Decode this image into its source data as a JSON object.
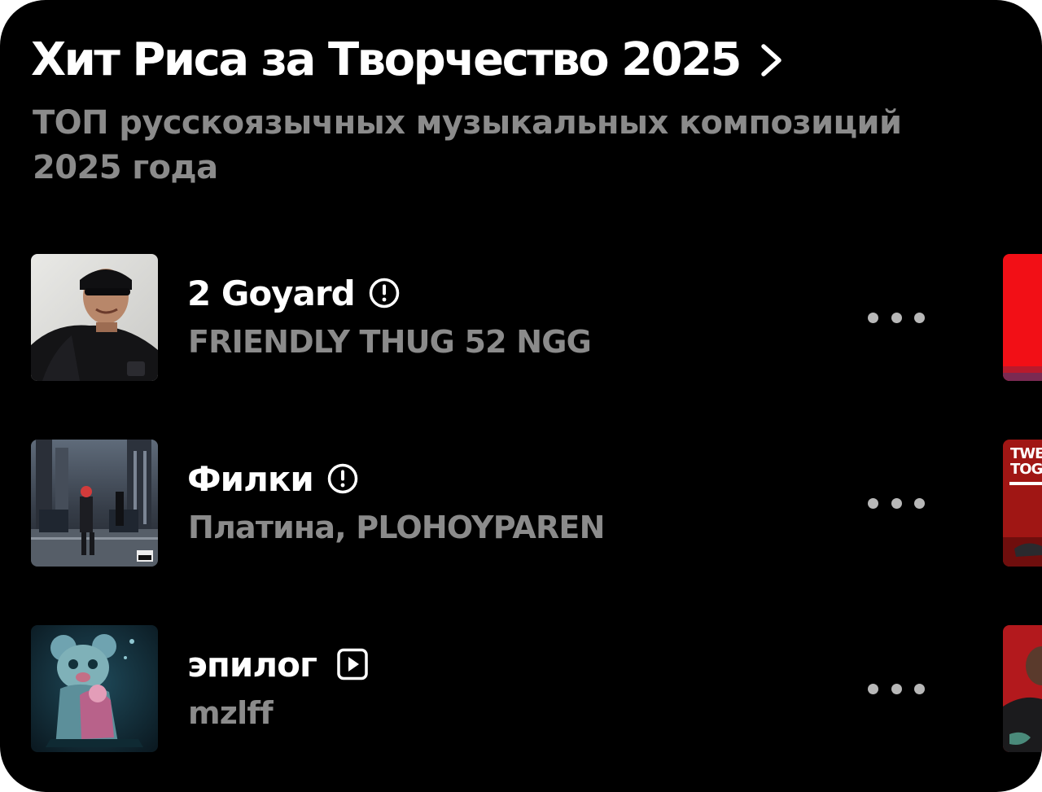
{
  "playlist": {
    "title": "Хит Риса за Творчество 2025",
    "chevron_icon": "chevron-right-icon",
    "description": "ТОП русскоязычных музыкальных композиций 2025 года"
  },
  "tracks": [
    {
      "title": "2 Goyard",
      "badge_icon": "explicit-icon",
      "artist": "FRIENDLY THUG 52 NGG",
      "more_icon": "more-dots-icon"
    },
    {
      "title": "Филки",
      "badge_icon": "explicit-icon",
      "artist": "Платина, PLOHOYPAREN",
      "more_icon": "more-dots-icon"
    },
    {
      "title": "эпилог",
      "badge_icon": "video-clip-icon",
      "artist": "mzlff",
      "more_icon": "more-dots-icon"
    }
  ],
  "next_column_peek": {
    "cover_2_text": "TWEA TOGE"
  },
  "colors": {
    "background": "#000000",
    "primary_text": "#ffffff",
    "secondary_text": "#8b8b8b",
    "more_dots": "#b8b8b8"
  }
}
